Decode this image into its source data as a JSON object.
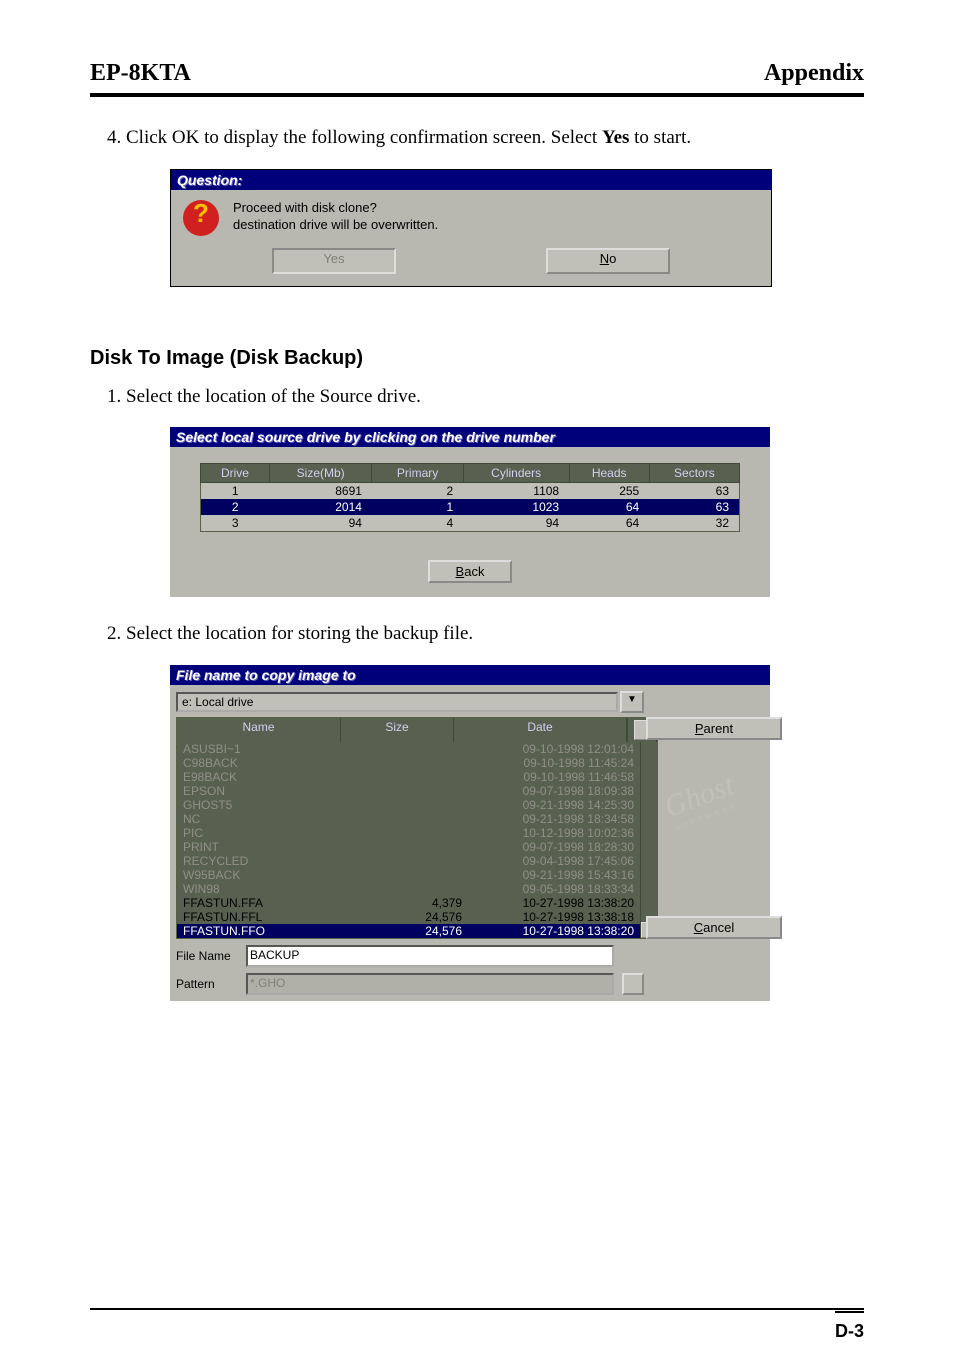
{
  "header": {
    "left": "EP-8KTA",
    "right": "Appendix"
  },
  "step4": {
    "text_before_bold": "Click OK to display the following confirmation screen.  Select ",
    "bold": "Yes",
    "text_after_bold": " to start."
  },
  "dlg1": {
    "title": "Question:",
    "line1": "Proceed with disk clone?",
    "line2": "destination drive will be overwritten.",
    "btn_yes": "Yes",
    "btn_no": "No"
  },
  "section": "Disk To Image (Disk Backup)",
  "step1": "Select the location of the Source drive.",
  "dlg2": {
    "title": "Select local source drive by clicking on the drive number",
    "headers": [
      "Drive",
      "Size(Mb)",
      "Primary",
      "Cylinders",
      "Heads",
      "Sectors"
    ],
    "rows": [
      {
        "drive": "1",
        "size": "8691",
        "primary": "2",
        "cyl": "1108",
        "heads": "255",
        "sectors": "63",
        "sel": false
      },
      {
        "drive": "2",
        "size": "2014",
        "primary": "1",
        "cyl": "1023",
        "heads": "64",
        "sectors": "63",
        "sel": true
      },
      {
        "drive": "3",
        "size": "94",
        "primary": "4",
        "cyl": "94",
        "heads": "64",
        "sectors": "32",
        "sel": false
      }
    ],
    "back": "Back"
  },
  "step2": "Select the location for storing the backup file.",
  "dlg3": {
    "title": "File name to copy image to",
    "combo": "e: Local drive",
    "headers": {
      "name": "Name",
      "size": "Size",
      "date": "Date"
    },
    "files": [
      {
        "name": "ASUSBI~1",
        "size": "",
        "date": "09-10-1998 12:01:04",
        "file": false,
        "sel": false
      },
      {
        "name": "C98BACK",
        "size": "",
        "date": "09-10-1998 11:45:24",
        "file": false,
        "sel": false
      },
      {
        "name": "E98BACK",
        "size": "",
        "date": "09-10-1998 11:46:58",
        "file": false,
        "sel": false
      },
      {
        "name": "EPSON",
        "size": "",
        "date": "09-07-1998 18:09:38",
        "file": false,
        "sel": false
      },
      {
        "name": "GHOST5",
        "size": "",
        "date": "09-21-1998 14:25:30",
        "file": false,
        "sel": false
      },
      {
        "name": "NC",
        "size": "",
        "date": "09-21-1998 18:34:58",
        "file": false,
        "sel": false
      },
      {
        "name": "PIC",
        "size": "",
        "date": "10-12-1998 10:02:36",
        "file": false,
        "sel": false
      },
      {
        "name": "PRINT",
        "size": "",
        "date": "09-07-1998 18:28:30",
        "file": false,
        "sel": false
      },
      {
        "name": "RECYCLED",
        "size": "",
        "date": "09-04-1998 17:45:06",
        "file": false,
        "sel": false
      },
      {
        "name": "W95BACK",
        "size": "",
        "date": "09-21-1998 15:43:16",
        "file": false,
        "sel": false
      },
      {
        "name": "WIN98",
        "size": "",
        "date": "09-05-1998 18:33:34",
        "file": false,
        "sel": false
      },
      {
        "name": "FFASTUN.FFA",
        "size": "4,379",
        "date": "10-27-1998 13:38:20",
        "file": true,
        "sel": false
      },
      {
        "name": "FFASTUN.FFL",
        "size": "24,576",
        "date": "10-27-1998 13:38:18",
        "file": true,
        "sel": false
      },
      {
        "name": "FFASTUN.FFO",
        "size": "24,576",
        "date": "10-27-1998 13:38:20",
        "file": true,
        "sel": true
      }
    ],
    "parent": "Parent",
    "cancel": "Cancel",
    "file_name_lbl": "File Name",
    "file_name_val": "BACKUP",
    "pattern_lbl": "Pattern",
    "pattern_val": "*.GHO",
    "brand": "Ghost",
    "brand_sub": "SOFTWARE"
  },
  "page_number": "D-3"
}
